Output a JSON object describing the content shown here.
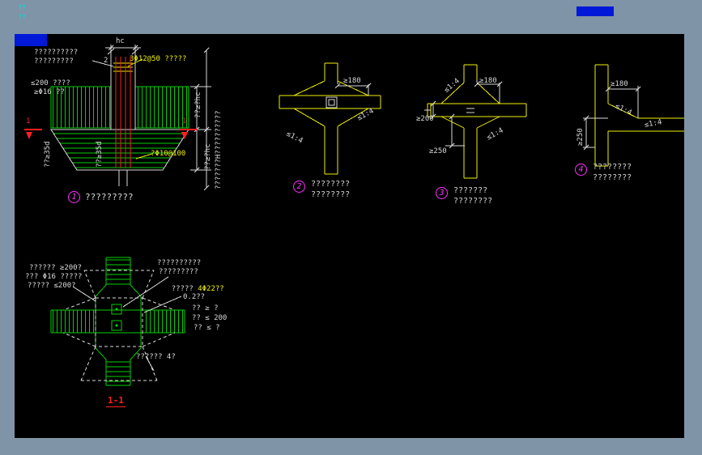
{
  "window": {
    "frame_color": "#7f94a6",
    "canvas_color": "#000000",
    "top_left_marks": [
      "??",
      "??"
    ]
  },
  "palette": {
    "white": "#d8d8d8",
    "green": "#00d000",
    "yellow": "#f0f000",
    "red": "#ff2020",
    "magenta": "#ff30ff",
    "cyan": "#00e0e0",
    "blue": "#0018d8"
  },
  "detail1": {
    "callout_number": "1",
    "caption": "?????????",
    "top_note_line1": "??????????",
    "top_note_line2": "?????????",
    "leader_number": "2",
    "bar_note": "3Φ12@50 ?????",
    "hc_label": "hc",
    "left_note_line1": "≤200 ????",
    "left_note_line2": "≥Φ16 ??",
    "rot_note_left": "??≥35d",
    "rot_note_mid": "??≥35d",
    "stirrup_note": "?Φ10@100",
    "right_dim_rot1": "??≥?hc",
    "right_dim_rot2": "??≥?hc",
    "right_col_note": "???????H??????????",
    "section_marker": "1"
  },
  "detail2": {
    "callout_number": "2",
    "caption_line1": "????????",
    "caption_line2": "????????",
    "dim_180": "≥180",
    "slope_label": "≤1:4"
  },
  "detail3": {
    "callout_number": "3",
    "caption_line1": "???????",
    "caption_line2": "????????",
    "dim_180": "≥180",
    "dim_200": "≥200",
    "dim_250": "≥250",
    "slope_label": "≤1:4"
  },
  "detail4": {
    "callout_number": "4",
    "caption_line1": "????????",
    "caption_line2": "????????",
    "dim_180": "≥180",
    "dim_250": "≥250",
    "slope_label": "≤1:4"
  },
  "section": {
    "title": "1-1",
    "left_note_line1": "?????? ≥200?",
    "left_note_line2": "??? Φ16 ?????",
    "left_note_line3": "????? ≤200?",
    "right_note_line1": "??????????",
    "right_note_line2": "?????????",
    "right_note_line3_white": "?????",
    "right_note_line3_yellow": "4Φ22??",
    "side_note_1": "0.2??",
    "side_note_2": "?? ≥ ?",
    "side_note_3": "?? ≤ 200",
    "side_note_4": "?? ≤ ?",
    "bottom_note": "?????? 4?"
  }
}
